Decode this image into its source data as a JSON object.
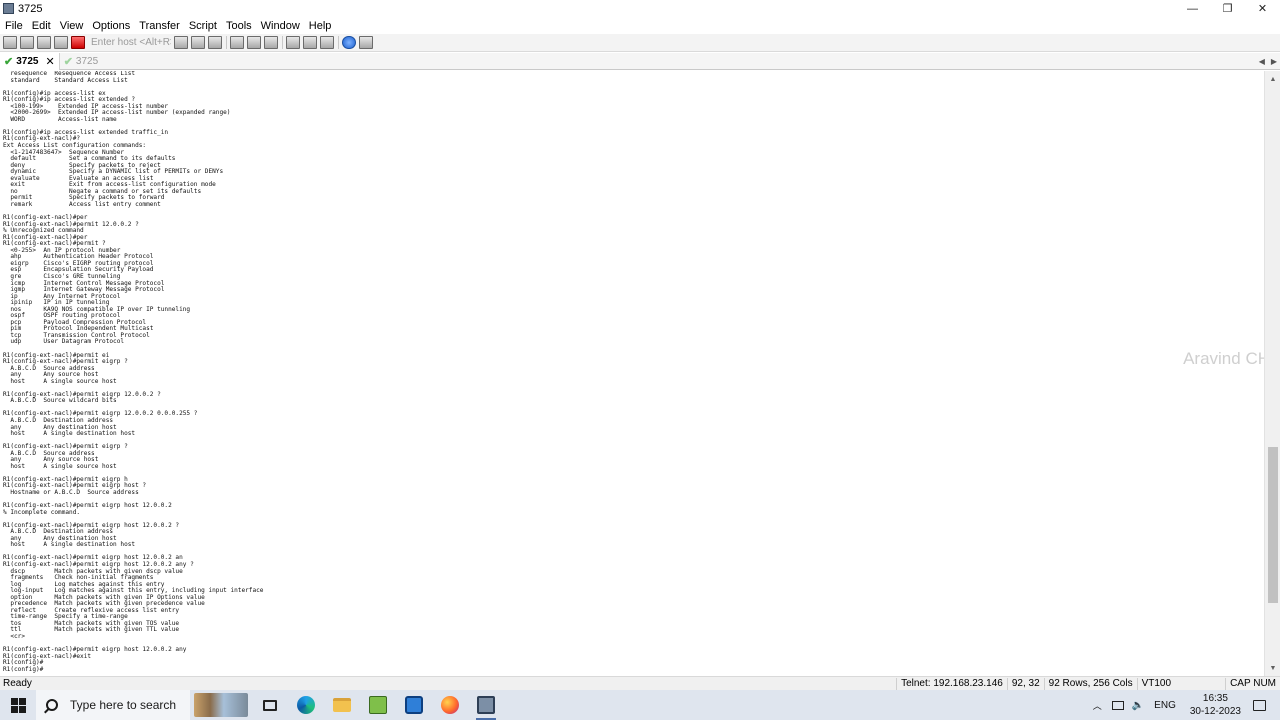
{
  "window": {
    "title": "3725",
    "min_glyph": "—",
    "max_glyph": "❐",
    "close_glyph": "✕"
  },
  "menu": [
    "File",
    "Edit",
    "View",
    "Options",
    "Transfer",
    "Script",
    "Tools",
    "Window",
    "Help"
  ],
  "toolbar": {
    "host_placeholder": "Enter host <Alt+R>"
  },
  "tabs": [
    {
      "label": "3725",
      "active": true,
      "close": "✕"
    },
    {
      "label": "3725",
      "active": false
    }
  ],
  "tab_nav": {
    "left": "◀",
    "right": "▶"
  },
  "terminal": {
    "lines": [
      "  resequence  Resequence Access List",
      "  standard    Standard Access List",
      "",
      "R1(config)#ip access-list ex",
      "R1(config)#ip access-list extended ?",
      "  <100-199>    Extended IP access-list number",
      "  <2000-2699>  Extended IP access-list number (expanded range)",
      "  WORD         Access-list name",
      "",
      "R1(config)#ip access-list extended traffic_in",
      "R1(config-ext-nacl)#?",
      "Ext Access List configuration commands:",
      "  <1-2147483647>  Sequence Number",
      "  default         Set a command to its defaults",
      "  deny            Specify packets to reject",
      "  dynamic         Specify a DYNAMIC list of PERMITs or DENYs",
      "  evaluate        Evaluate an access list",
      "  exit            Exit from access-list configuration mode",
      "  no              Negate a command or set its defaults",
      "  permit          Specify packets to forward",
      "  remark          Access list entry comment",
      "",
      "R1(config-ext-nacl)#per",
      "R1(config-ext-nacl)#permit 12.0.0.2 ?",
      "% Unrecognized command",
      "R1(config-ext-nacl)#per",
      "R1(config-ext-nacl)#permit ?",
      "  <0-255>  An IP protocol number",
      "  ahp      Authentication Header Protocol",
      "  eigrp    Cisco's EIGRP routing protocol",
      "  esp      Encapsulation Security Payload",
      "  gre      Cisco's GRE tunneling",
      "  icmp     Internet Control Message Protocol",
      "  igmp     Internet Gateway Message Protocol",
      "  ip       Any Internet Protocol",
      "  ipinip   IP in IP tunneling",
      "  nos      KA9Q NOS compatible IP over IP tunneling",
      "  ospf     OSPF routing protocol",
      "  pcp      Payload Compression Protocol",
      "  pim      Protocol Independent Multicast",
      "  tcp      Transmission Control Protocol",
      "  udp      User Datagram Protocol",
      "",
      "R1(config-ext-nacl)#permit ei",
      "R1(config-ext-nacl)#permit eigrp ?",
      "  A.B.C.D  Source address",
      "  any      Any source host",
      "  host     A single source host",
      "",
      "R1(config-ext-nacl)#permit eigrp 12.0.0.2 ?",
      "  A.B.C.D  Source wildcard bits",
      "",
      "R1(config-ext-nacl)#permit eigrp 12.0.0.2 0.0.0.255 ?",
      "  A.B.C.D  Destination address",
      "  any      Any destination host",
      "  host     A single destination host",
      "",
      "R1(config-ext-nacl)#permit eigrp ?",
      "  A.B.C.D  Source address",
      "  any      Any source host",
      "  host     A single source host",
      "",
      "R1(config-ext-nacl)#permit eigrp h",
      "R1(config-ext-nacl)#permit eigrp host ?",
      "  Hostname or A.B.C.D  Source address",
      "",
      "R1(config-ext-nacl)#permit eigrp host 12.0.0.2",
      "% Incomplete command.",
      "",
      "R1(config-ext-nacl)#permit eigrp host 12.0.0.2 ?",
      "  A.B.C.D  Destination address",
      "  any      Any destination host",
      "  host     A single destination host",
      "",
      "R1(config-ext-nacl)#permit eigrp host 12.0.0.2 an",
      "R1(config-ext-nacl)#permit eigrp host 12.0.0.2 any ?",
      "  dscp        Match packets with given dscp value",
      "  fragments   Check non-initial fragments",
      "  log         Log matches against this entry",
      "  log-input   Log matches against this entry, including input interface",
      "  option      Match packets with given IP Options value",
      "  precedence  Match packets with given precedence value",
      "  reflect     Create reflexive access list entry",
      "  time-range  Specify a time-range",
      "  tos         Match packets with given TOS value",
      "  ttl         Match packets with given TTL value",
      "  <cr>",
      "",
      "R1(config-ext-nacl)#permit eigrp host 12.0.0.2 any",
      "R1(config-ext-nacl)#exit",
      "R1(config)#",
      "R1(config)#"
    ]
  },
  "watermark": "Aravind CH",
  "scrollbar": {
    "up": "▲",
    "down": "▼"
  },
  "status": {
    "ready": "Ready",
    "connection": "Telnet: 192.168.23.146",
    "cursor": "92,  32",
    "size": "92 Rows, 256 Cols",
    "emulation": "VT100",
    "locks": "CAP  NUM"
  },
  "taskbar": {
    "search_placeholder": "Type here to search",
    "tray_chevron": "︿",
    "volume_glyph": "🔈",
    "language": "ENG",
    "time": "16:35",
    "date": "30-12-2023"
  }
}
